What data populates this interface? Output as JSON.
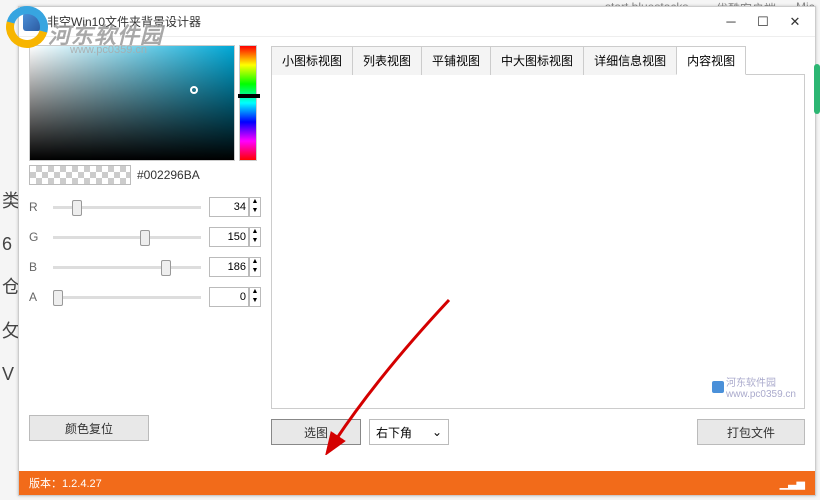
{
  "background": {
    "topright1": "start bluestacks",
    "topright2": "优酷客户端",
    "topright3": "Mic"
  },
  "overlay": {
    "brand": "河东软件园",
    "url": "www.pc0359.cn"
  },
  "window": {
    "title": "非空Win10文件夹背景设计器",
    "hex": "#002296BA",
    "channels": {
      "r": {
        "label": "R",
        "value": "34",
        "pos": 13
      },
      "g": {
        "label": "G",
        "value": "150",
        "pos": 59
      },
      "b": {
        "label": "B",
        "value": "186",
        "pos": 73
      },
      "a": {
        "label": "A",
        "value": "0",
        "pos": 0
      }
    },
    "buttons": {
      "reset": "颜色复位",
      "select_image": "选图",
      "position": "右下角",
      "pack": "打包文件"
    },
    "tabs": [
      "小图标视图",
      "列表视图",
      "平铺视图",
      "中大图标视图",
      "详细信息视图",
      "内容视图"
    ],
    "active_tab": 5,
    "watermark": {
      "text": "河东软件园",
      "url": "www.pc0359.cn"
    }
  },
  "statusbar": {
    "version_label": "版本：",
    "version": "1.2.4.27"
  },
  "side_chars": [
    "类",
    "6",
    "仓",
    "攵",
    "V"
  ]
}
